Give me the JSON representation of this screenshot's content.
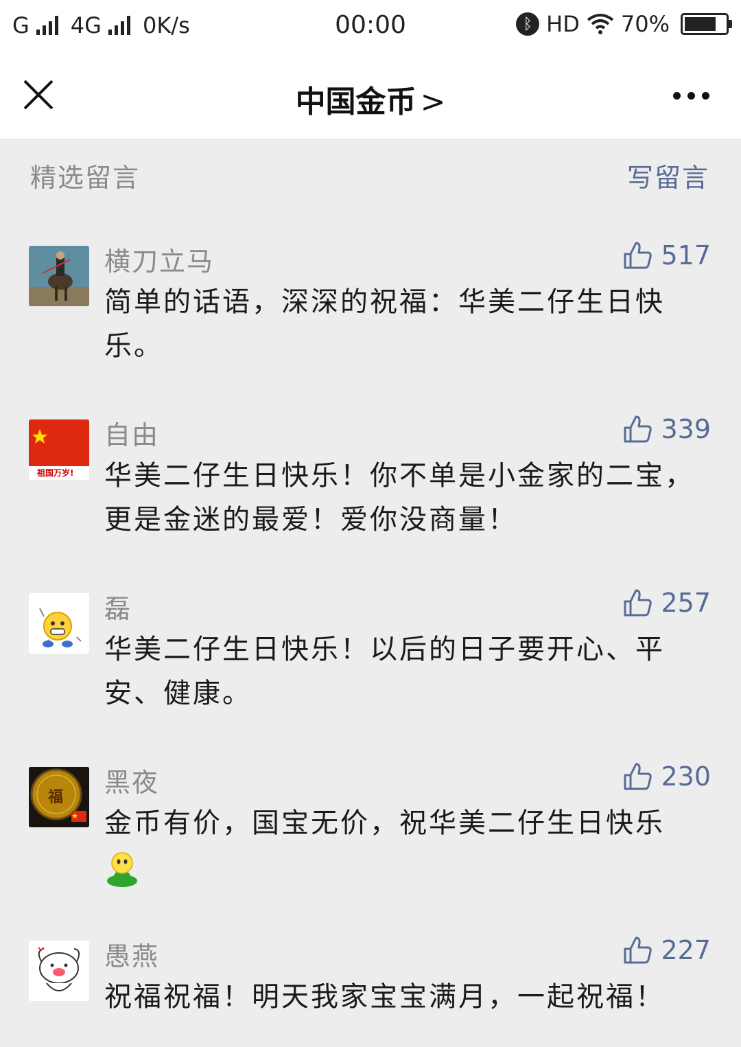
{
  "status_bar": {
    "carrier1": "G",
    "carrier2": "4G",
    "speed": "0K/s",
    "time": "00:00",
    "hd": "HD",
    "battery": "70%"
  },
  "navbar": {
    "title": "中国金币",
    "chevron": ">"
  },
  "section": {
    "title": "精选留言",
    "write_label": "写留言"
  },
  "comments": [
    {
      "nickname": "横刀立马",
      "likes": "517",
      "text": "简单的话语，深深的祝福：华美二仔生日快乐。"
    },
    {
      "nickname": "自由",
      "likes": "339",
      "text": "华美二仔生日快乐！你不单是小金家的二宝，更是金迷的最爱！爱你没商量！",
      "avatar_text": "祖国万岁!"
    },
    {
      "nickname": "磊",
      "likes": "257",
      "text": "华美二仔生日快乐！以后的日子要开心、平安、健康。"
    },
    {
      "nickname": "黑夜",
      "likes": "230",
      "text": "金币有价，国宝无价，祝华美二仔生日快乐",
      "avatar_text": "福"
    },
    {
      "nickname": "愚燕",
      "likes": "227",
      "text": "祝福祝福！明天我家宝宝满月，一起祝福！"
    }
  ],
  "colors": {
    "link": "#576b95",
    "background": "#ededed",
    "muted": "#8a8a8a"
  }
}
